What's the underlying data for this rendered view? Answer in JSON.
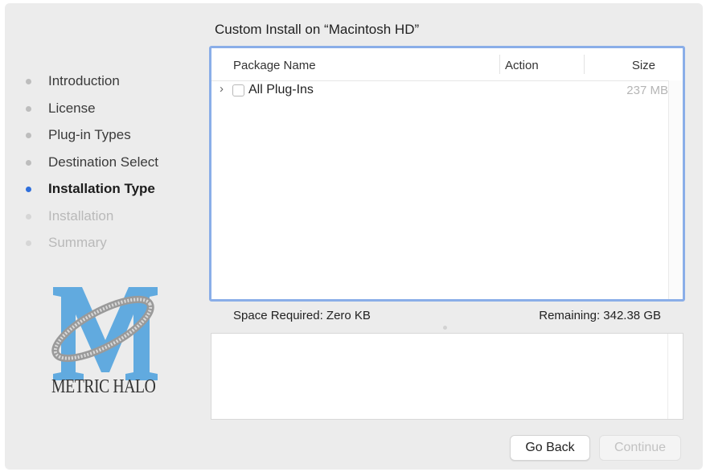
{
  "sidebar": {
    "steps": [
      {
        "label": "Introduction",
        "state": "done"
      },
      {
        "label": "License",
        "state": "done"
      },
      {
        "label": "Plug-in Types",
        "state": "done"
      },
      {
        "label": "Destination Select",
        "state": "done"
      },
      {
        "label": "Installation Type",
        "state": "active"
      },
      {
        "label": "Installation",
        "state": "pending"
      },
      {
        "label": "Summary",
        "state": "pending"
      }
    ],
    "logo_text": "METRIC HALO"
  },
  "main": {
    "title": "Custom Install on “Macintosh HD”",
    "table": {
      "columns": [
        "Package Name",
        "Action",
        "Size"
      ],
      "rows": [
        {
          "name": "All Plug-Ins",
          "action": "",
          "size": "237 MB",
          "checked": false,
          "expandable": true
        }
      ]
    },
    "space_required": "Space Required:  Zero KB",
    "remaining": "Remaining:  342.38 GB"
  },
  "buttons": {
    "back": "Go Back",
    "continue": "Continue"
  },
  "colors": {
    "accent": "#2f6fdc",
    "focus_ring": "#8aaee8",
    "logo_blue": "#5aa7de"
  },
  "icons": [
    "step-dot-icon",
    "disclosure-chevron-icon",
    "checkbox",
    "metric-halo-logo"
  ]
}
